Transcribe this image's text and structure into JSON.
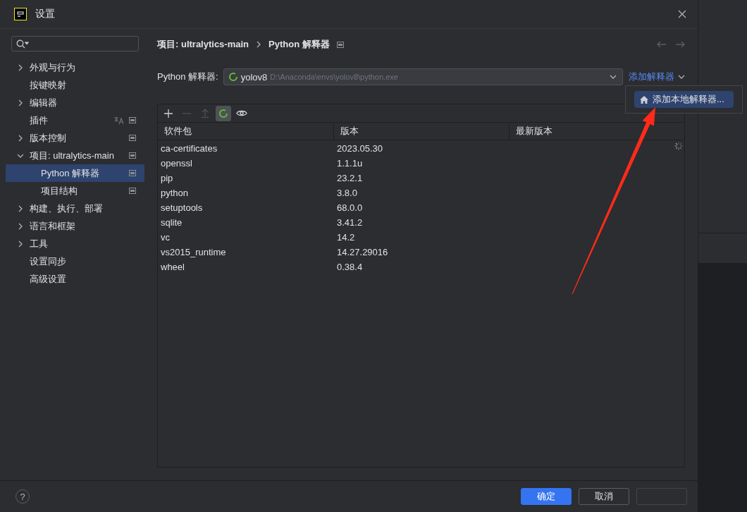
{
  "window": {
    "title": "设置"
  },
  "sidebar": {
    "items": [
      {
        "label": "外观与行为",
        "expandable": true,
        "expanded": false,
        "selected": false
      },
      {
        "label": "按键映射",
        "expandable": false,
        "selected": false
      },
      {
        "label": "编辑器",
        "expandable": true,
        "expanded": false,
        "selected": false
      },
      {
        "label": "插件",
        "expandable": false,
        "selected": false,
        "translatable": true,
        "project_level": true
      },
      {
        "label": "版本控制",
        "expandable": true,
        "expanded": false,
        "selected": false,
        "project_level": true
      },
      {
        "label": "项目: ultralytics-main",
        "expandable": true,
        "expanded": true,
        "selected": false,
        "project_level": true,
        "children": [
          {
            "label": "Python 解释器",
            "selected": true,
            "project_level": true
          },
          {
            "label": "项目结构",
            "selected": false,
            "project_level": true
          }
        ]
      },
      {
        "label": "构建、执行、部署",
        "expandable": true,
        "expanded": false,
        "selected": false
      },
      {
        "label": "语言和框架",
        "expandable": true,
        "expanded": false,
        "selected": false
      },
      {
        "label": "工具",
        "expandable": true,
        "expanded": false,
        "selected": false
      },
      {
        "label": "设置同步",
        "expandable": false,
        "selected": false
      },
      {
        "label": "高级设置",
        "expandable": false,
        "selected": false
      }
    ]
  },
  "breadcrumb": {
    "parent": "项目: ultralytics-main",
    "current": "Python 解释器"
  },
  "interpreter": {
    "label": "Python 解释器:",
    "name": "yolov8",
    "path": "D:\\Anaconda\\envs\\yolov8\\python.exe",
    "add_link": "添加解释器"
  },
  "popup": {
    "items": [
      {
        "label": "添加本地解释器...",
        "selected": true
      }
    ]
  },
  "toolbar": [
    {
      "kind": "add",
      "disabled": false,
      "selected": false
    },
    {
      "kind": "remove",
      "disabled": true,
      "selected": false
    },
    {
      "kind": "upgrade",
      "disabled": true,
      "selected": false
    },
    {
      "kind": "loading",
      "disabled": false,
      "selected": true
    },
    {
      "kind": "eye",
      "disabled": false,
      "selected": false
    }
  ],
  "table": {
    "columns": [
      "软件包",
      "版本",
      "最新版本"
    ],
    "rows": [
      [
        "ca-certificates",
        "2023.05.30"
      ],
      [
        "openssl",
        "1.1.1u"
      ],
      [
        "pip",
        "23.2.1"
      ],
      [
        "python",
        "3.8.0"
      ],
      [
        "setuptools",
        "68.0.0"
      ],
      [
        "sqlite",
        "3.41.2"
      ],
      [
        "vc",
        "14.2"
      ],
      [
        "vs2015_runtime",
        "14.27.29016"
      ],
      [
        "wheel",
        "0.38.4"
      ]
    ]
  },
  "footer": {
    "help": "?",
    "buttons": [
      {
        "label": "确定",
        "kind": "primary"
      },
      {
        "label": "取消",
        "kind": "normal"
      },
      {
        "kind": "disabled"
      }
    ]
  }
}
